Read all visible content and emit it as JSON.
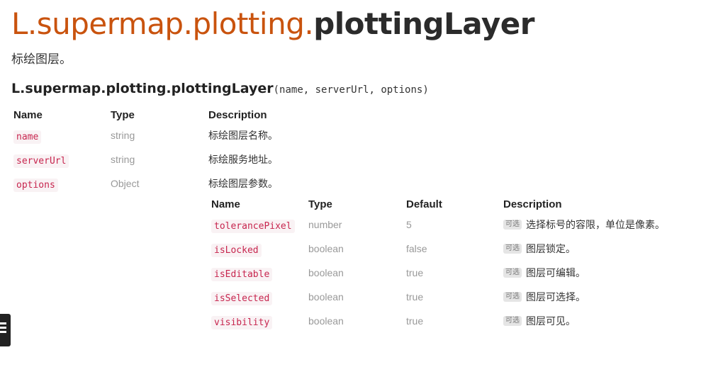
{
  "header": {
    "namespace": "L.supermap.plotting.",
    "name": "plottingLayer",
    "description": "标绘图层。"
  },
  "signature": {
    "function": "L.supermap.plotting.plottingLayer",
    "params": "(name, serverUrl, options)"
  },
  "params_table": {
    "headers": [
      "Name",
      "Type",
      "Description"
    ],
    "rows": [
      {
        "name": "name",
        "type": "string",
        "description": "标绘图层名称。"
      },
      {
        "name": "serverUrl",
        "type": "string",
        "description": "标绘服务地址。"
      },
      {
        "name": "options",
        "type": "Object",
        "description": "标绘图层参数。"
      }
    ]
  },
  "options_table": {
    "headers": [
      "Name",
      "Type",
      "Default",
      "Description"
    ],
    "optional_badge": "可选",
    "rows": [
      {
        "name": "tolerancePixel",
        "type": "number",
        "default": "5",
        "description": "选择标号的容限，单位是像素。"
      },
      {
        "name": "isLocked",
        "type": "boolean",
        "default": "false",
        "description": "图层锁定。"
      },
      {
        "name": "isEditable",
        "type": "boolean",
        "default": "true",
        "description": "图层可编辑。"
      },
      {
        "name": "isSelected",
        "type": "boolean",
        "default": "true",
        "description": "图层可选择。"
      },
      {
        "name": "visibility",
        "type": "boolean",
        "default": "true",
        "description": "图层可见。"
      }
    ]
  },
  "ui": {
    "menu_icon": "hamburger-menu-icon"
  }
}
